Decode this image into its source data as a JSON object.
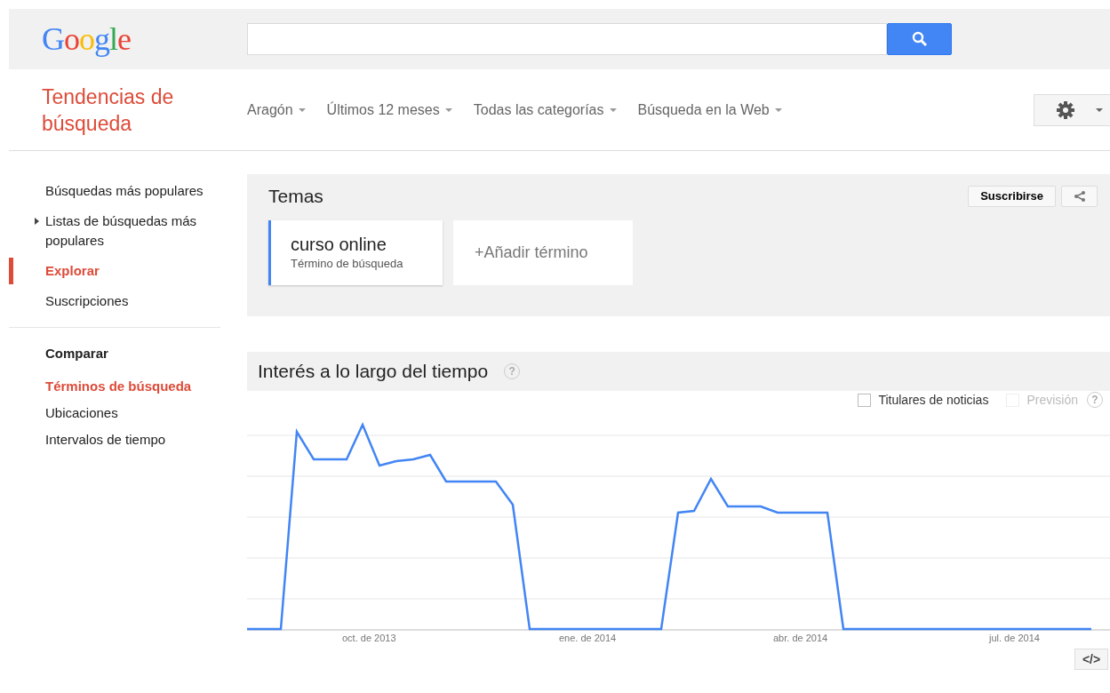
{
  "header": {
    "logo": "Google"
  },
  "title": "Tendencias de búsqueda",
  "filters": [
    "Aragón",
    "Últimos 12 meses",
    "Todas las categorías",
    "Búsqueda en la Web"
  ],
  "sidebar": {
    "items": [
      {
        "label": "Búsquedas más populares",
        "selected": false,
        "expandable": false
      },
      {
        "label": "Listas de búsquedas más populares",
        "selected": false,
        "expandable": true
      },
      {
        "label": "Explorar",
        "selected": true,
        "expandable": false
      },
      {
        "label": "Suscripciones",
        "selected": false,
        "expandable": false
      }
    ],
    "compare": {
      "heading": "Comparar",
      "items": [
        {
          "label": "Términos de búsqueda",
          "selected": true
        },
        {
          "label": "Ubicaciones",
          "selected": false
        },
        {
          "label": "Intervalos de tiempo",
          "selected": false
        }
      ]
    }
  },
  "topics": {
    "heading": "Temas",
    "subscribe": "Suscribirse",
    "terms": [
      {
        "title": "curso online",
        "subtitle": "Término de búsqueda"
      }
    ],
    "add": "+Añadir término"
  },
  "interest": {
    "heading": "Interés a lo largo del tiempo",
    "help": "?",
    "options": [
      {
        "label": "Titulares de noticias",
        "checked": false,
        "disabled": false
      },
      {
        "label": "Previsión",
        "checked": false,
        "disabled": true
      }
    ],
    "option_help": "?",
    "x_labels": [
      "oct. de 2013",
      "ene. de 2014",
      "abr. de 2014",
      "jul. de 2014"
    ],
    "embed": "</>"
  }
}
